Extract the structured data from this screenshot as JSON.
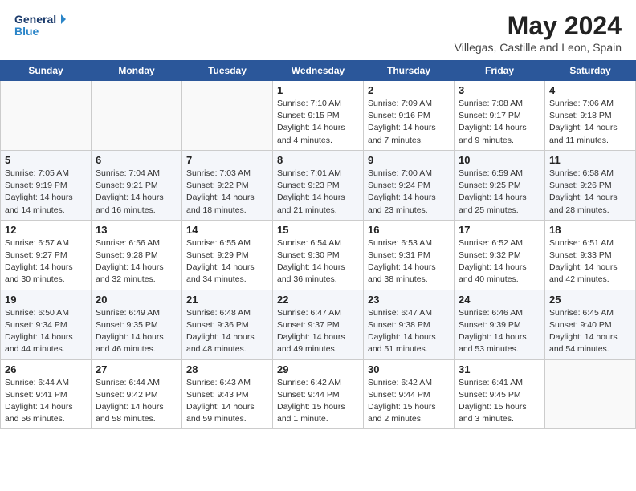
{
  "header": {
    "logo_line1": "General",
    "logo_line2": "Blue",
    "month": "May 2024",
    "location": "Villegas, Castille and Leon, Spain"
  },
  "days_of_week": [
    "Sunday",
    "Monday",
    "Tuesday",
    "Wednesday",
    "Thursday",
    "Friday",
    "Saturday"
  ],
  "weeks": [
    [
      {
        "day": "",
        "info": ""
      },
      {
        "day": "",
        "info": ""
      },
      {
        "day": "",
        "info": ""
      },
      {
        "day": "1",
        "info": "Sunrise: 7:10 AM\nSunset: 9:15 PM\nDaylight: 14 hours\nand 4 minutes."
      },
      {
        "day": "2",
        "info": "Sunrise: 7:09 AM\nSunset: 9:16 PM\nDaylight: 14 hours\nand 7 minutes."
      },
      {
        "day": "3",
        "info": "Sunrise: 7:08 AM\nSunset: 9:17 PM\nDaylight: 14 hours\nand 9 minutes."
      },
      {
        "day": "4",
        "info": "Sunrise: 7:06 AM\nSunset: 9:18 PM\nDaylight: 14 hours\nand 11 minutes."
      }
    ],
    [
      {
        "day": "5",
        "info": "Sunrise: 7:05 AM\nSunset: 9:19 PM\nDaylight: 14 hours\nand 14 minutes."
      },
      {
        "day": "6",
        "info": "Sunrise: 7:04 AM\nSunset: 9:21 PM\nDaylight: 14 hours\nand 16 minutes."
      },
      {
        "day": "7",
        "info": "Sunrise: 7:03 AM\nSunset: 9:22 PM\nDaylight: 14 hours\nand 18 minutes."
      },
      {
        "day": "8",
        "info": "Sunrise: 7:01 AM\nSunset: 9:23 PM\nDaylight: 14 hours\nand 21 minutes."
      },
      {
        "day": "9",
        "info": "Sunrise: 7:00 AM\nSunset: 9:24 PM\nDaylight: 14 hours\nand 23 minutes."
      },
      {
        "day": "10",
        "info": "Sunrise: 6:59 AM\nSunset: 9:25 PM\nDaylight: 14 hours\nand 25 minutes."
      },
      {
        "day": "11",
        "info": "Sunrise: 6:58 AM\nSunset: 9:26 PM\nDaylight: 14 hours\nand 28 minutes."
      }
    ],
    [
      {
        "day": "12",
        "info": "Sunrise: 6:57 AM\nSunset: 9:27 PM\nDaylight: 14 hours\nand 30 minutes."
      },
      {
        "day": "13",
        "info": "Sunrise: 6:56 AM\nSunset: 9:28 PM\nDaylight: 14 hours\nand 32 minutes."
      },
      {
        "day": "14",
        "info": "Sunrise: 6:55 AM\nSunset: 9:29 PM\nDaylight: 14 hours\nand 34 minutes."
      },
      {
        "day": "15",
        "info": "Sunrise: 6:54 AM\nSunset: 9:30 PM\nDaylight: 14 hours\nand 36 minutes."
      },
      {
        "day": "16",
        "info": "Sunrise: 6:53 AM\nSunset: 9:31 PM\nDaylight: 14 hours\nand 38 minutes."
      },
      {
        "day": "17",
        "info": "Sunrise: 6:52 AM\nSunset: 9:32 PM\nDaylight: 14 hours\nand 40 minutes."
      },
      {
        "day": "18",
        "info": "Sunrise: 6:51 AM\nSunset: 9:33 PM\nDaylight: 14 hours\nand 42 minutes."
      }
    ],
    [
      {
        "day": "19",
        "info": "Sunrise: 6:50 AM\nSunset: 9:34 PM\nDaylight: 14 hours\nand 44 minutes."
      },
      {
        "day": "20",
        "info": "Sunrise: 6:49 AM\nSunset: 9:35 PM\nDaylight: 14 hours\nand 46 minutes."
      },
      {
        "day": "21",
        "info": "Sunrise: 6:48 AM\nSunset: 9:36 PM\nDaylight: 14 hours\nand 48 minutes."
      },
      {
        "day": "22",
        "info": "Sunrise: 6:47 AM\nSunset: 9:37 PM\nDaylight: 14 hours\nand 49 minutes."
      },
      {
        "day": "23",
        "info": "Sunrise: 6:47 AM\nSunset: 9:38 PM\nDaylight: 14 hours\nand 51 minutes."
      },
      {
        "day": "24",
        "info": "Sunrise: 6:46 AM\nSunset: 9:39 PM\nDaylight: 14 hours\nand 53 minutes."
      },
      {
        "day": "25",
        "info": "Sunrise: 6:45 AM\nSunset: 9:40 PM\nDaylight: 14 hours\nand 54 minutes."
      }
    ],
    [
      {
        "day": "26",
        "info": "Sunrise: 6:44 AM\nSunset: 9:41 PM\nDaylight: 14 hours\nand 56 minutes."
      },
      {
        "day": "27",
        "info": "Sunrise: 6:44 AM\nSunset: 9:42 PM\nDaylight: 14 hours\nand 58 minutes."
      },
      {
        "day": "28",
        "info": "Sunrise: 6:43 AM\nSunset: 9:43 PM\nDaylight: 14 hours\nand 59 minutes."
      },
      {
        "day": "29",
        "info": "Sunrise: 6:42 AM\nSunset: 9:44 PM\nDaylight: 15 hours\nand 1 minute."
      },
      {
        "day": "30",
        "info": "Sunrise: 6:42 AM\nSunset: 9:44 PM\nDaylight: 15 hours\nand 2 minutes."
      },
      {
        "day": "31",
        "info": "Sunrise: 6:41 AM\nSunset: 9:45 PM\nDaylight: 15 hours\nand 3 minutes."
      },
      {
        "day": "",
        "info": ""
      }
    ]
  ]
}
